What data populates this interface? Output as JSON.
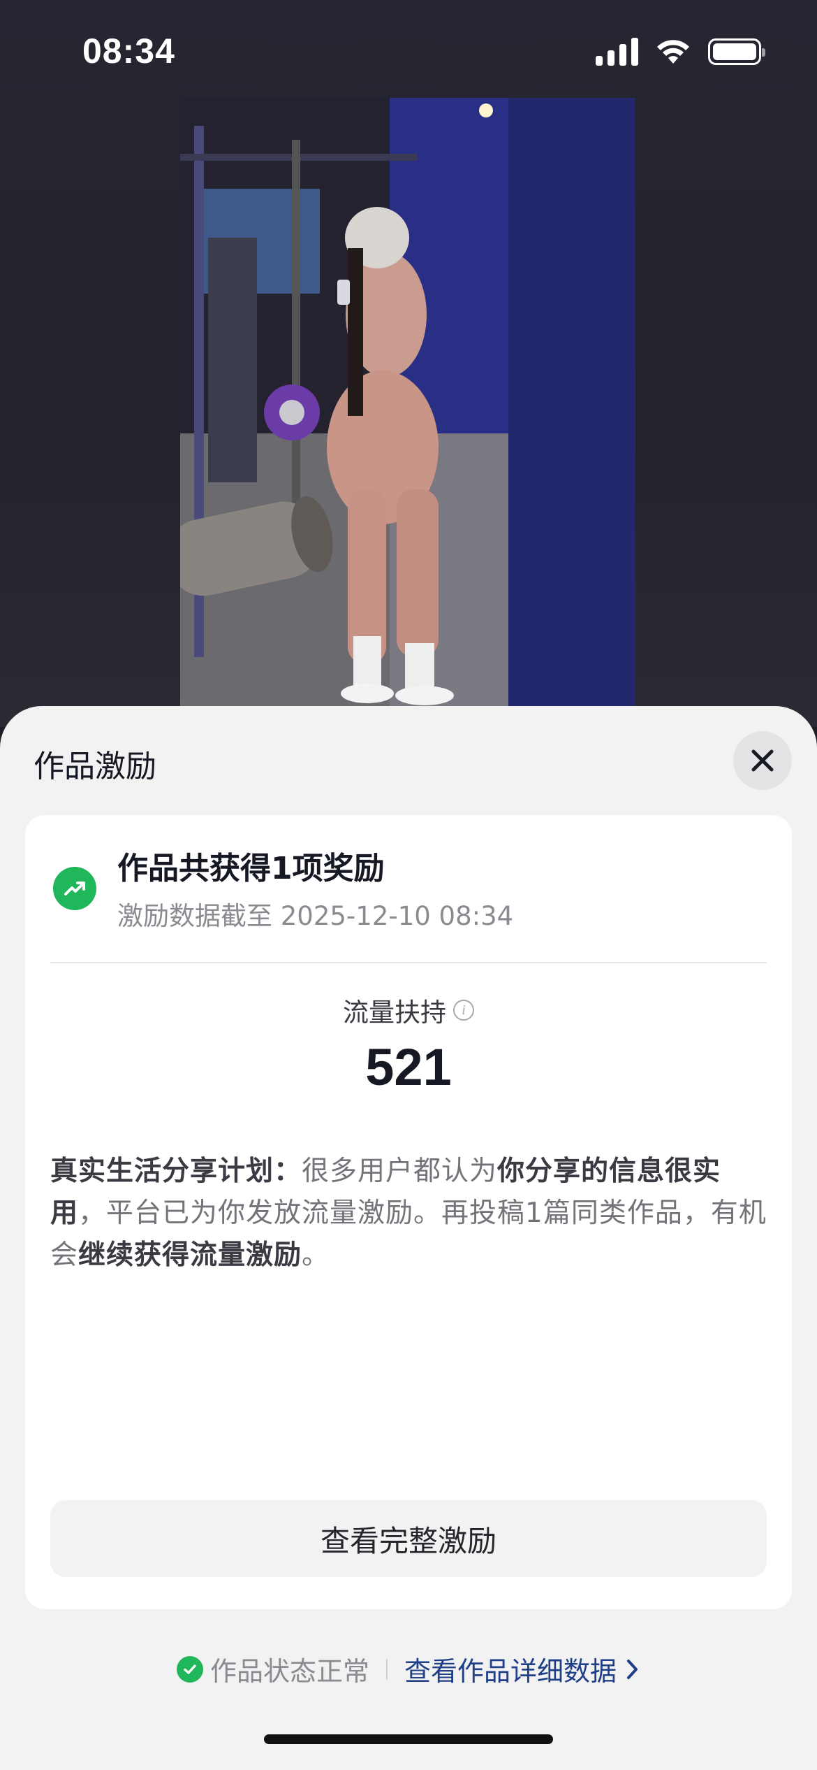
{
  "status_bar": {
    "time": "08:34",
    "icons": [
      "cellular-signal-icon",
      "wifi-icon",
      "battery-icon"
    ]
  },
  "sheet": {
    "title": "作品激励",
    "close_icon": "close-icon"
  },
  "reward_card": {
    "icon": "trending-up-icon",
    "title": "作品共获得1项奖励",
    "subtitle": "激励数据截至 2025-12-10 08:34",
    "metric": {
      "label": "流量扶持",
      "value": "521",
      "info_icon": "info-icon"
    },
    "description": {
      "bold_1": "真实生活分享计划：",
      "text_1": "很多用户都认为",
      "bold_2": "你分享的信息很实用",
      "text_2": "，平台已为你发放流量激励。再投稿1篇同类作品，有机会",
      "bold_3": "继续获得流量激励",
      "text_3": "。"
    },
    "button_label": "查看完整激励"
  },
  "footer": {
    "status_icon": "check-circle-icon",
    "status_text": "作品状态正常",
    "link_text": "查看作品详细数据",
    "link_icon": "chevron-right-icon"
  },
  "colors": {
    "accent_green": "#20b65a",
    "link_blue": "#1f3f86",
    "sheet_bg": "#f2f2f2"
  }
}
